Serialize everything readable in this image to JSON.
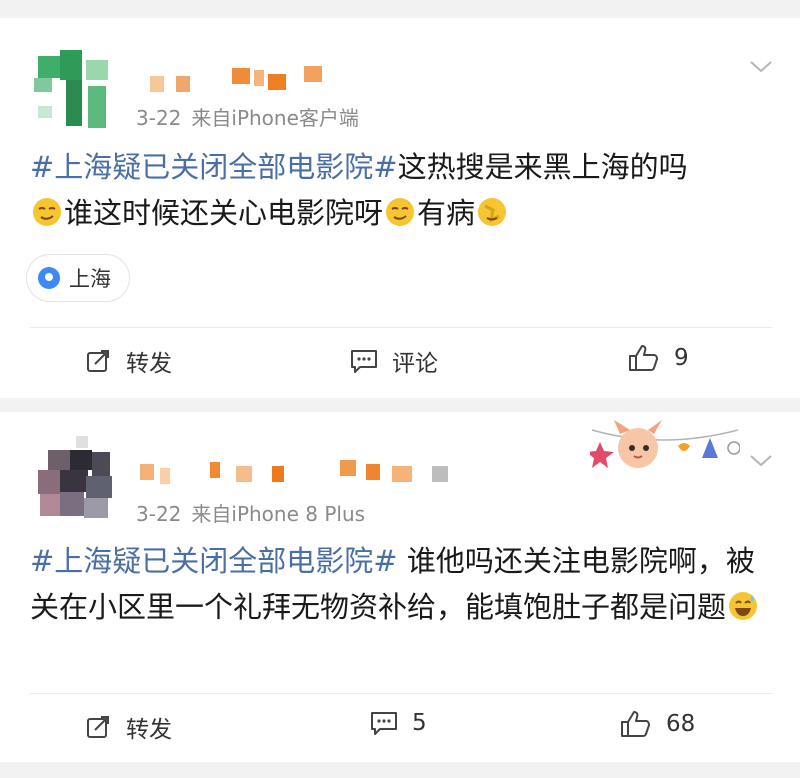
{
  "posts": [
    {
      "time": "3-22",
      "source": "来自iPhone客户端",
      "topic": "#上海疑已关闭全部电影院#",
      "text_a": "这热搜是来黑上海的吗",
      "text_b": "谁这时候还关心电影院呀",
      "text_c": "有病",
      "location": "上海",
      "repost_label": "转发",
      "comment_label": "评论",
      "likes": "9"
    },
    {
      "time": "3-22",
      "source": "来自iPhone 8 Plus",
      "topic": "#上海疑已关闭全部电影院#",
      "text_a": " 谁他吗还关注电影院啊，被关在小区里一个礼拜无物资补给，能填饱肚子都是问题",
      "repost_label": "转发",
      "comments": "5",
      "likes": "68"
    }
  ],
  "colors": {
    "topic": "#4a6fa5",
    "meta": "#8a8a8a",
    "background": "#f2f2f2",
    "location_pin": "#3d8af7"
  },
  "icons": [
    "chevron-down-icon",
    "location-pin-icon",
    "repost-icon",
    "comment-icon",
    "like-icon",
    "smirk-emoji-icon",
    "facepalm-emoji-icon",
    "sweat-smile-emoji-icon"
  ]
}
